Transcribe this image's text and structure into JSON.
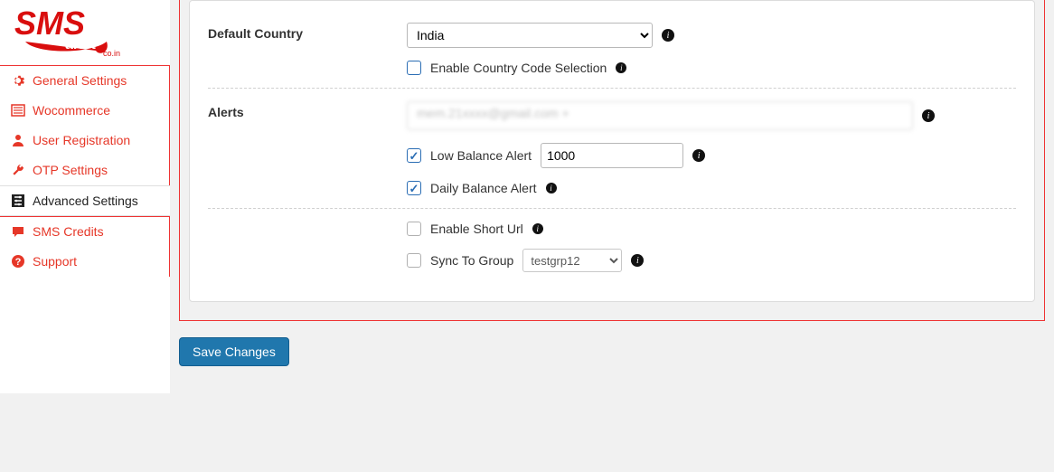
{
  "logo": {
    "text_main": "SMS",
    "text_sub": "alert",
    "text_domain": "co.in"
  },
  "sidebar": {
    "items": [
      {
        "label": "General Settings",
        "icon": "gear-icon"
      },
      {
        "label": "Wocommerce",
        "icon": "list-icon"
      },
      {
        "label": "User Registration",
        "icon": "user-icon"
      },
      {
        "label": "OTP Settings",
        "icon": "wrench-icon"
      },
      {
        "label": "Advanced Settings",
        "icon": "sliders-icon",
        "active": true
      },
      {
        "label": "SMS Credits",
        "icon": "chat-icon"
      },
      {
        "label": "Support",
        "icon": "help-icon"
      }
    ]
  },
  "form": {
    "default_country": {
      "label": "Default Country",
      "value": "India",
      "enable_cc_label": "Enable Country Code Selection",
      "enable_cc_checked": false
    },
    "alerts": {
      "label": "Alerts",
      "email_value": "mem.21xxxx@gmail.com  +",
      "low_balance": {
        "label": "Low Balance Alert",
        "checked": true,
        "value": "1000"
      },
      "daily_balance": {
        "label": "Daily Balance Alert",
        "checked": true
      }
    },
    "short_url": {
      "label": "Enable Short Url",
      "checked": false
    },
    "sync_group": {
      "label": "Sync To Group",
      "checked": false,
      "value": "testgrp12"
    },
    "save_label": "Save Changes"
  }
}
